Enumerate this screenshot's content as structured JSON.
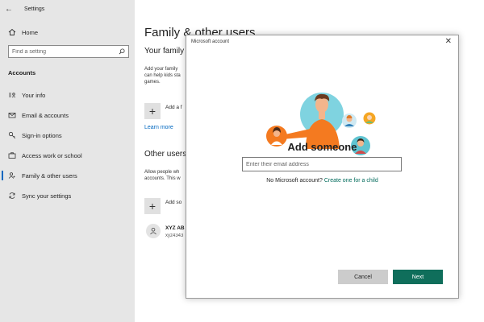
{
  "window": {
    "title": "Settings"
  },
  "sidebar": {
    "home_label": "Home",
    "search_placeholder": "Find a setting",
    "section_heading": "Accounts",
    "items": [
      {
        "label": "Your info",
        "icon": "person-card-icon"
      },
      {
        "label": "Email & accounts",
        "icon": "mail-icon"
      },
      {
        "label": "Sign-in options",
        "icon": "key-icon"
      },
      {
        "label": "Access work or school",
        "icon": "briefcase-icon"
      },
      {
        "label": "Family & other users",
        "icon": "people-icon",
        "selected": true
      },
      {
        "label": "Sync your settings",
        "icon": "sync-icon"
      }
    ]
  },
  "main": {
    "title": "Family & other users",
    "family_heading": "Your family",
    "family_text_line1": "Add your family",
    "family_text_line2": "can help kids sta",
    "family_text_line3": "games.",
    "add_family_label": "Add a f",
    "learn_more": "Learn more",
    "other_heading": "Other users",
    "other_text_line1": "Allow people wh",
    "other_text_line2": "accounts. This w",
    "add_other_label": "Add so",
    "user_name": "XYZ AB",
    "user_email": "xyz4343"
  },
  "dialog": {
    "title": "Microsoft account",
    "close_glyph": "✕",
    "heading": "Add someone",
    "email_placeholder": "Enter their email address",
    "no_account_text": "No Microsoft account?",
    "create_link": "Create one for a child",
    "cancel_label": "Cancel",
    "next_label": "Next"
  },
  "colors": {
    "accent": "#0067c0",
    "next_button": "#0f6e5b",
    "link_green": "#006a5b",
    "sidebar_bg": "#e6e6e6",
    "illus_orange": "#f47a20",
    "illus_teal": "#7fd3e0"
  }
}
